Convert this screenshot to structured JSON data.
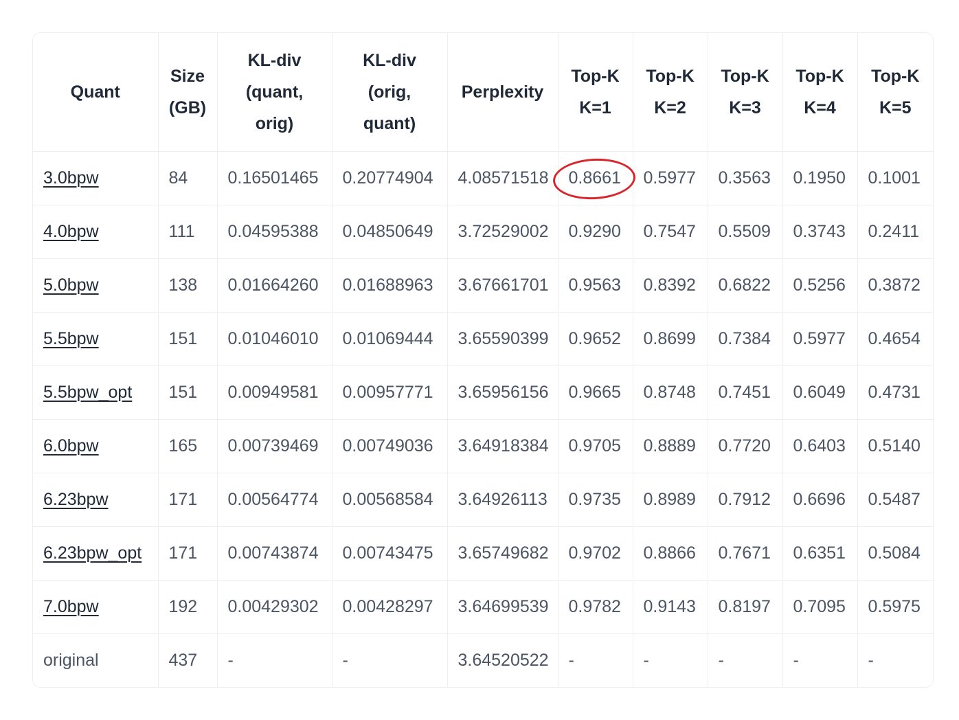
{
  "table": {
    "headers": [
      [
        "Quant"
      ],
      [
        "Size",
        "(GB)"
      ],
      [
        "KL-div",
        "(quant,",
        "orig)"
      ],
      [
        "KL-div",
        "(orig,",
        "quant)"
      ],
      [
        "Perplexity"
      ],
      [
        "Top-K",
        "K=1"
      ],
      [
        "Top-K",
        "K=2"
      ],
      [
        "Top-K",
        "K=3"
      ],
      [
        "Top-K",
        "K=4"
      ],
      [
        "Top-K",
        "K=5"
      ]
    ],
    "rows": [
      {
        "quant": "3.0bpw",
        "link": true,
        "cells": [
          "84",
          "0.16501465",
          "0.20774904",
          "4.08571518",
          "0.8661",
          "0.5977",
          "0.3563",
          "0.1950",
          "0.1001"
        ]
      },
      {
        "quant": "4.0bpw",
        "link": true,
        "cells": [
          "111",
          "0.04595388",
          "0.04850649",
          "3.72529002",
          "0.9290",
          "0.7547",
          "0.5509",
          "0.3743",
          "0.2411"
        ]
      },
      {
        "quant": "5.0bpw",
        "link": true,
        "cells": [
          "138",
          "0.01664260",
          "0.01688963",
          "3.67661701",
          "0.9563",
          "0.8392",
          "0.6822",
          "0.5256",
          "0.3872"
        ]
      },
      {
        "quant": "5.5bpw",
        "link": true,
        "cells": [
          "151",
          "0.01046010",
          "0.01069444",
          "3.65590399",
          "0.9652",
          "0.8699",
          "0.7384",
          "0.5977",
          "0.4654"
        ]
      },
      {
        "quant": "5.5bpw_opt",
        "link": true,
        "cells": [
          "151",
          "0.00949581",
          "0.00957771",
          "3.65956156",
          "0.9665",
          "0.8748",
          "0.7451",
          "0.6049",
          "0.4731"
        ]
      },
      {
        "quant": "6.0bpw",
        "link": true,
        "cells": [
          "165",
          "0.00739469",
          "0.00749036",
          "3.64918384",
          "0.9705",
          "0.8889",
          "0.7720",
          "0.6403",
          "0.5140"
        ]
      },
      {
        "quant": "6.23bpw",
        "link": true,
        "cells": [
          "171",
          "0.00564774",
          "0.00568584",
          "3.64926113",
          "0.9735",
          "0.8989",
          "0.7912",
          "0.6696",
          "0.5487"
        ]
      },
      {
        "quant": "6.23bpw_opt",
        "link": true,
        "cells": [
          "171",
          "0.00743874",
          "0.00743475",
          "3.65749682",
          "0.9702",
          "0.8866",
          "0.7671",
          "0.6351",
          "0.5084"
        ]
      },
      {
        "quant": "7.0bpw",
        "link": true,
        "cells": [
          "192",
          "0.00429302",
          "0.00428297",
          "3.64699539",
          "0.9782",
          "0.9143",
          "0.8197",
          "0.7095",
          "0.5975"
        ]
      },
      {
        "quant": "original",
        "link": false,
        "cells": [
          "437",
          "-",
          "-",
          "3.64520522",
          "-",
          "-",
          "-",
          "-",
          "-"
        ]
      }
    ],
    "highlight": {
      "row": 0,
      "cell": 4,
      "color": "#d8262c"
    }
  }
}
